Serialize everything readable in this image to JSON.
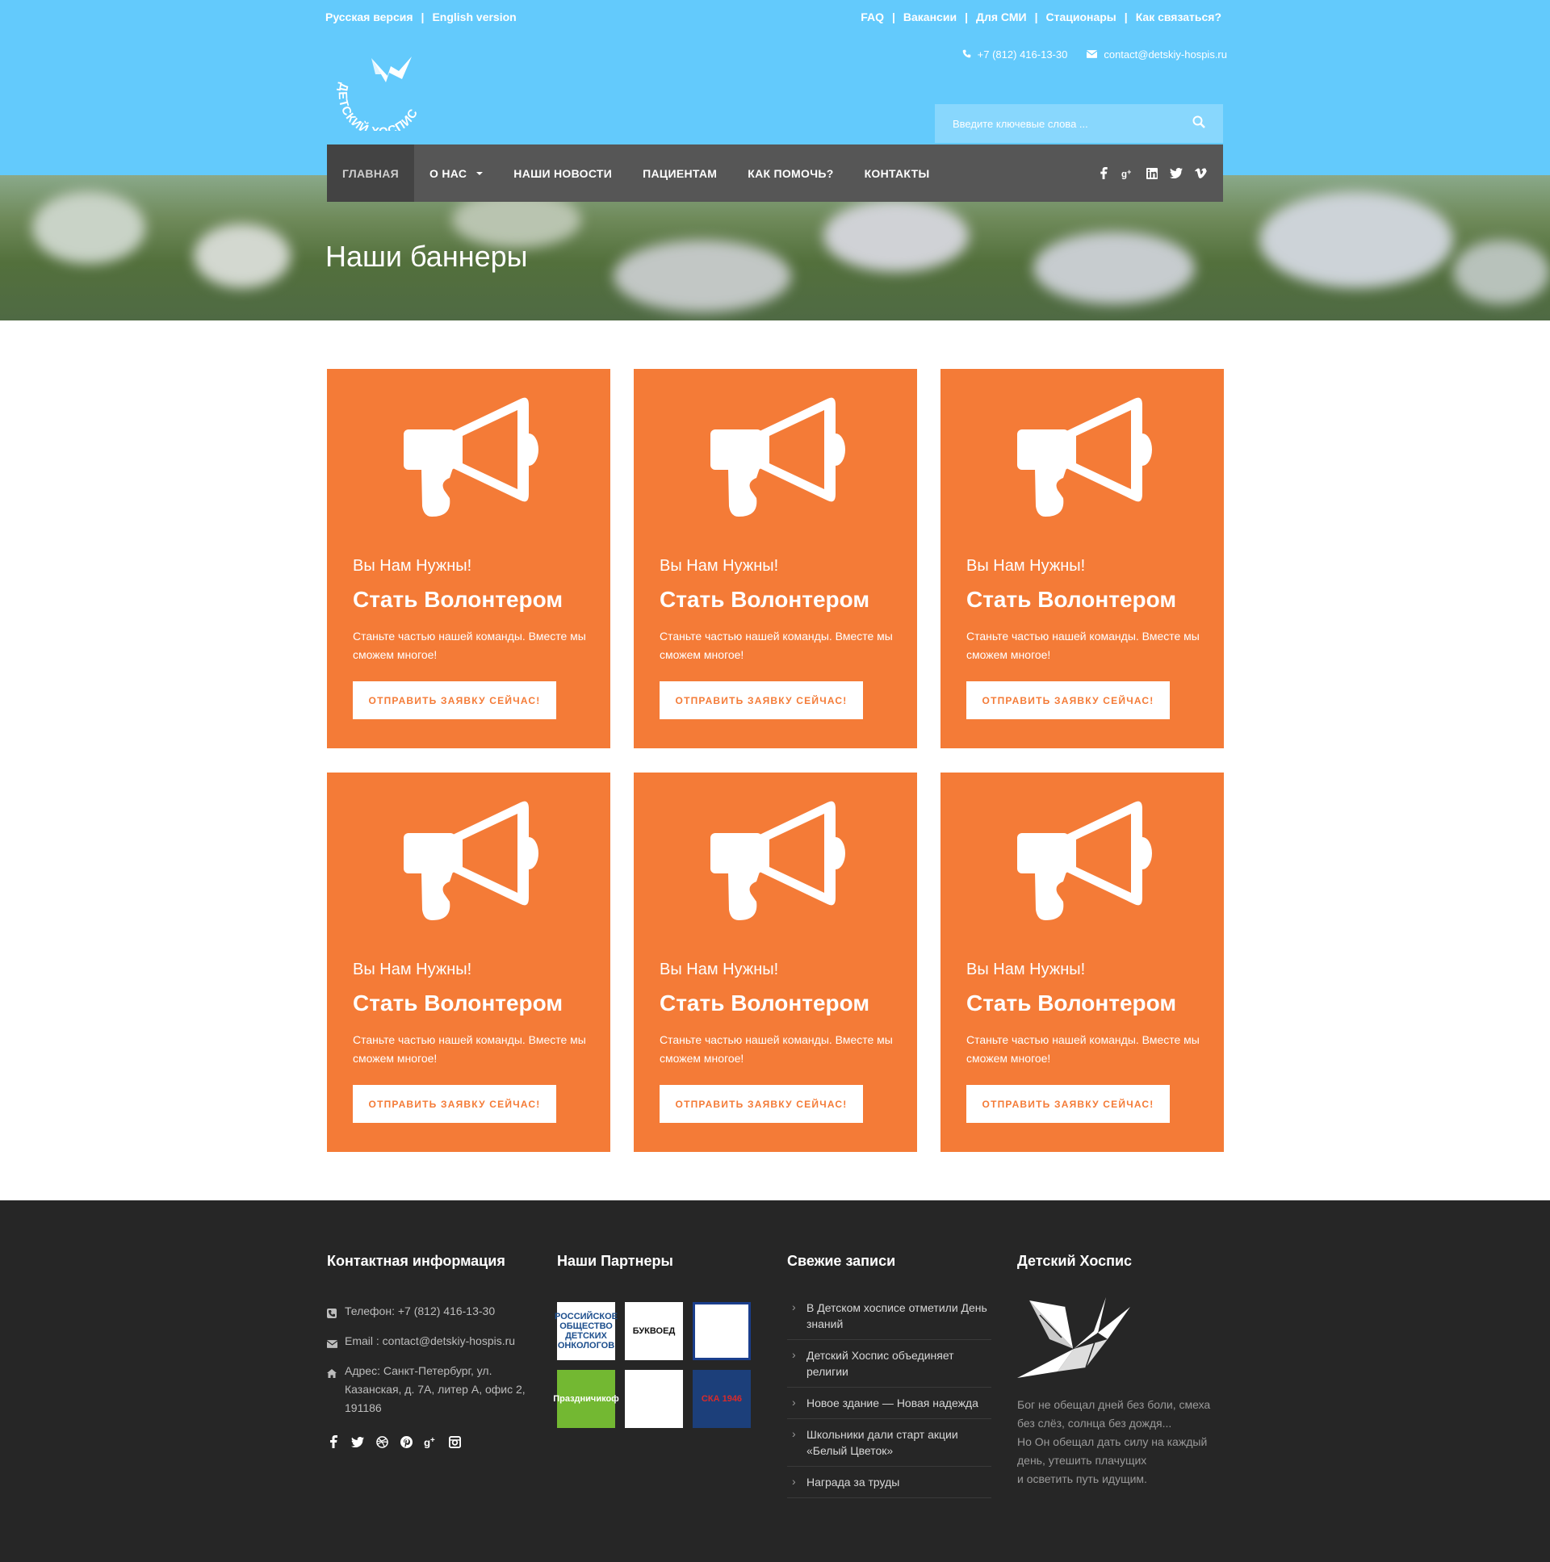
{
  "header": {
    "lang": [
      "Русская версия",
      "English version"
    ],
    "top_links": [
      "FAQ",
      "Вакансии",
      "Для СМИ",
      "Стационары",
      "Как связаться?"
    ],
    "phone": "+7 (812) 416-13-30",
    "email": "contact@detskiy-hospis.ru",
    "logo_text": "ДЕТСКИЙ ХОСПИС",
    "search_placeholder": "Введите ключевые слова ..."
  },
  "nav": {
    "items": [
      "ГЛАВНАЯ",
      "О НАС",
      "НАШИ НОВОСТИ",
      "ПАЦИЕНТАМ",
      "КАК ПОМОЧЬ?",
      "КОНТАКТЫ"
    ],
    "social_icons": [
      "facebook-icon",
      "google-plus-icon",
      "linkedin-icon",
      "twitter-icon",
      "vimeo-icon"
    ]
  },
  "hero": {
    "title": "Наши баннеры"
  },
  "cards": [
    {
      "subtitle": "Вы Нам Нужны!",
      "title": "Стать Волонтером",
      "desc": "Станьте частью нашей команды. Вместе мы сможем многое!",
      "button": "ОТПРАВИТЬ ЗАЯВКУ СЕЙЧАС!"
    },
    {
      "subtitle": "Вы Нам Нужны!",
      "title": "Стать Волонтером",
      "desc": "Станьте частью нашей команды. Вместе мы сможем многое!",
      "button": "ОТПРАВИТЬ ЗАЯВКУ СЕЙЧАС!"
    },
    {
      "subtitle": "Вы Нам Нужны!",
      "title": "Стать Волонтером",
      "desc": "Станьте частью нашей команды. Вместе мы сможем многое!",
      "button": "ОТПРАВИТЬ ЗАЯВКУ СЕЙЧАС!"
    },
    {
      "subtitle": "Вы Нам Нужны!",
      "title": "Стать Волонтером",
      "desc": "Станьте частью нашей команды. Вместе мы сможем многое!",
      "button": "ОТПРАВИТЬ ЗАЯВКУ СЕЙЧАС!"
    },
    {
      "subtitle": "Вы Нам Нужны!",
      "title": "Стать Волонтером",
      "desc": "Станьте частью нашей команды. Вместе мы сможем многое!",
      "button": "ОТПРАВИТЬ ЗАЯВКУ СЕЙЧАС!"
    },
    {
      "subtitle": "Вы Нам Нужны!",
      "title": "Стать Волонтером",
      "desc": "Станьте частью нашей команды. Вместе мы сможем многое!",
      "button": "ОТПРАВИТЬ ЗАЯВКУ СЕЙЧАС!"
    }
  ],
  "footer": {
    "contact": {
      "heading": "Контактная информация",
      "phone": "Телефон: +7 (812) 416-13-30",
      "email": "Email : contact@detskiy-hospis.ru",
      "address": "Адрес: Санкт-Петербург, ул. Казанская, д. 7А, литер А, офис 2, 191186",
      "social_icons": [
        "facebook-icon",
        "twitter-icon",
        "dribbble-icon",
        "pinterest-icon",
        "google-plus-icon",
        "instagram-icon"
      ]
    },
    "partners": {
      "heading": "Наши Партнеры",
      "items": [
        {
          "label": "РОССИЙСКОЕ ОБЩЕСТВО ДЕТСКИХ ОНКОЛОГОВ",
          "bg": "#ffffff",
          "fg": "#1b4d8c"
        },
        {
          "label": "БУКВОЕД",
          "bg": "#ffffff",
          "fg": "#111111"
        },
        {
          "label": "",
          "bg": "#ffffff",
          "fg": "#1a3e8c"
        },
        {
          "label": "Праздничикоф",
          "bg": "#73b832",
          "fg": "#ffffff"
        },
        {
          "label": "",
          "bg": "#ffffff",
          "fg": "#d42a2a"
        },
        {
          "label": "СКА 1946",
          "bg": "#1c3f7a",
          "fg": "#d92a2a"
        }
      ]
    },
    "posts": {
      "heading": "Свежие записи",
      "items": [
        "В Детском хосписе отметили День знаний",
        "Детский Хоспис объединяет религии",
        "Новое здание — Новая надежда",
        "Школьники дали старт акции «Белый Цветок»",
        "Награда за труды"
      ]
    },
    "hospice": {
      "heading": "Детский Хоспис",
      "quote_lines": [
        "Бог не обещал дней без боли, смеха",
        "без слёз, солнца без дождя...",
        "Но Он обещал дать силу на каждый",
        "день, утешить плачущих",
        "и осветить путь идущим."
      ]
    }
  },
  "colors": {
    "header_bg": "#63cafc",
    "nav_bg": "#565656",
    "card_bg": "#f47b37",
    "footer_bg": "#262626"
  }
}
